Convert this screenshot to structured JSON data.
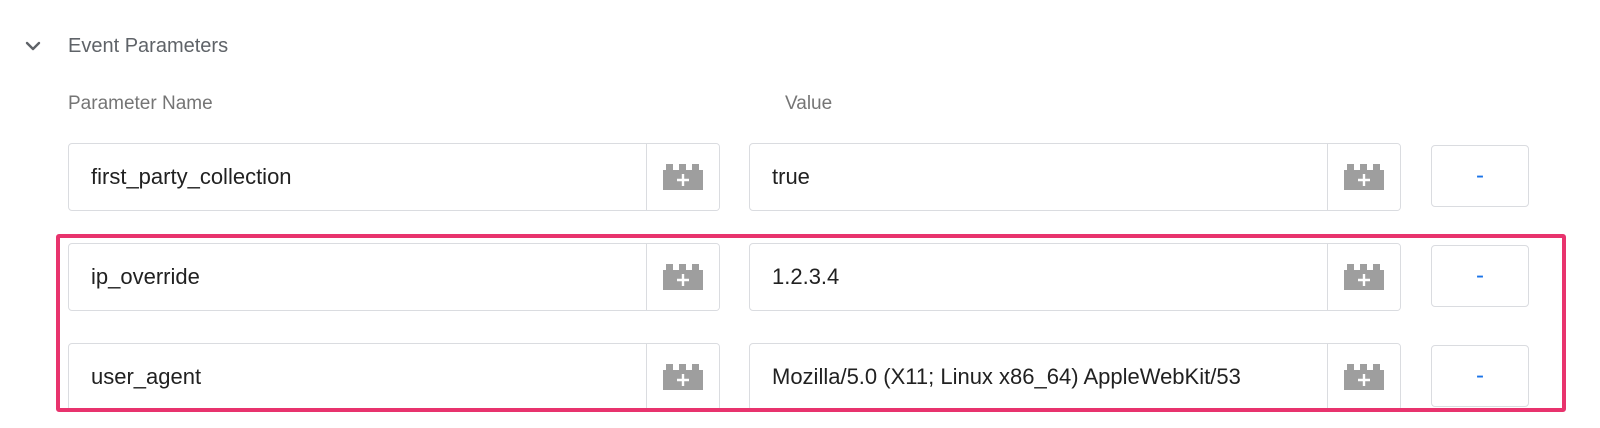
{
  "section": {
    "title": "Event Parameters",
    "expanded_icon": "chevron-down-icon"
  },
  "columns": {
    "name_label": "Parameter Name",
    "value_label": "Value"
  },
  "rows": [
    {
      "name": "first_party_collection",
      "value": "true",
      "remove_label": "-"
    },
    {
      "name": "ip_override",
      "value": "1.2.3.4",
      "remove_label": "-"
    },
    {
      "name": "user_agent",
      "value": "Mozilla/5.0 (X11; Linux x86_64) AppleWebKit/53",
      "remove_label": "-"
    }
  ],
  "variable_icon": "variable-picker-icon",
  "colors": {
    "highlight": "#e8336d",
    "remove_text": "#1a73e8",
    "border": "#dadce0"
  }
}
